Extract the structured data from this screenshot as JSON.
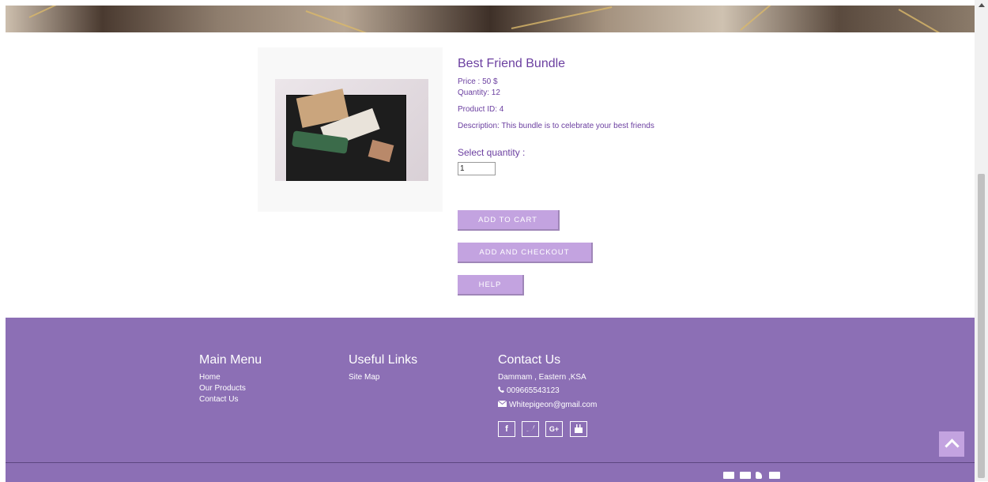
{
  "product": {
    "title": "Best Friend Bundle",
    "price": "Price : 50 $",
    "quantity": "Quantity: 12",
    "product_id": "Product ID: 4",
    "description": "Description: This bundle is to celebrate your best friends",
    "select_quantity_label": "Select quantity :",
    "quantity_value": "1"
  },
  "buttons": {
    "add_to_cart": "ADD TO CART",
    "add_and_checkout": "ADD AND CHECKOUT",
    "help": "HELP"
  },
  "footer": {
    "main_menu": {
      "heading": "Main Menu",
      "links": [
        "Home",
        "Our Products",
        "Contact Us"
      ]
    },
    "useful_links": {
      "heading": "Useful Links",
      "links": [
        "Site Map"
      ]
    },
    "contact": {
      "heading": "Contact Us",
      "address": "Dammam , Eastern ,KSA",
      "phone": "009665543123",
      "email": "Whitepigeon@gmail.com"
    },
    "social": [
      "f",
      "t",
      "G+",
      "yt"
    ],
    "payment_icons": [
      "card-icon",
      "visa-icon",
      "paypal-icon",
      "credit-card-icon"
    ]
  },
  "colors": {
    "accent": "#c3a3e0",
    "footer": "#8c6fb5",
    "text": "#6b3fa0"
  }
}
